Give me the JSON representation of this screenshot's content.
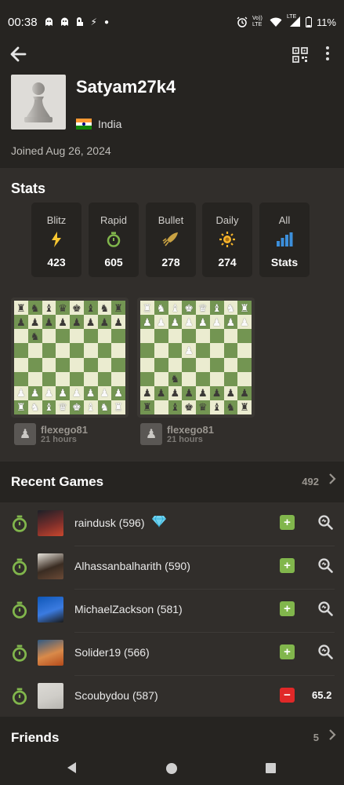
{
  "status_bar": {
    "time": "00:38",
    "notification_icons": [
      "ghost-icon",
      "ghost-icon",
      "notification-icon",
      "bolt-icon",
      "dot-icon"
    ],
    "system_icons": [
      "alarm-icon",
      "volte-icon",
      "wifi-icon",
      "lte-signal-icon",
      "battery-icon"
    ],
    "volte_text": "Vo)) LTE",
    "lte_text": "LTE",
    "battery": "11%"
  },
  "profile": {
    "username": "Satyam27k4",
    "country": "India",
    "joined": "Joined Aug 26, 2024"
  },
  "stats": {
    "title": "Stats",
    "cards": [
      {
        "label": "Blitz",
        "value": "423",
        "icon": "lightning-icon",
        "color": "#f7c631"
      },
      {
        "label": "Rapid",
        "value": "605",
        "icon": "stopwatch-icon",
        "color": "#81b64c"
      },
      {
        "label": "Bullet",
        "value": "278",
        "icon": "bullet-icon",
        "color": "#c9a243"
      },
      {
        "label": "Daily",
        "value": "274",
        "icon": "sun-icon",
        "color": "#f7b52b"
      },
      {
        "label": "All",
        "value": "Stats",
        "icon": "bar-chart-icon",
        "color": "#3c8fdb"
      }
    ]
  },
  "ongoing_games": [
    {
      "opponent": "flexego81",
      "time": "21 hours",
      "board": [
        "rnbqkbnr",
        "pppppppp",
        ".n......",
        "........",
        "........",
        "........",
        "PPPPPPPP",
        "RNBQKBNR"
      ]
    },
    {
      "opponent": "flexego81",
      "time": "21 hours",
      "board": [
        "RNBKQBNR",
        "PPPPPPPP",
        "........",
        "...P....",
        "........",
        "..n.....",
        "pppppppp",
        "r.bkqbnr"
      ]
    }
  ],
  "recent_games": {
    "title": "Recent Games",
    "count": "492",
    "games": [
      {
        "opponent": "raindusk (596)",
        "has_badge": true,
        "result": "win",
        "result_symbol": "+",
        "accuracy": null,
        "avatar_colors": [
          "#1c2028",
          "#7a2e2a",
          "#c9472e"
        ]
      },
      {
        "opponent": "Alhassanbalharith (590)",
        "has_badge": false,
        "result": "win",
        "result_symbol": "+",
        "accuracy": null,
        "avatar_colors": [
          "#e8e4dc",
          "#3a2c22",
          "#6b4a36"
        ]
      },
      {
        "opponent": "MichaelZackson (581)",
        "has_badge": false,
        "result": "win",
        "result_symbol": "+",
        "accuracy": null,
        "avatar_colors": [
          "#0f57b8",
          "#3b7be0",
          "#1a1a1a"
        ]
      },
      {
        "opponent": "Solider19 (566)",
        "has_badge": false,
        "result": "win",
        "result_symbol": "+",
        "accuracy": null,
        "avatar_colors": [
          "#2f5a84",
          "#d98a4a",
          "#b34a1a"
        ]
      },
      {
        "opponent": "Scoubydou (587)",
        "has_badge": false,
        "result": "loss",
        "result_symbol": "−",
        "accuracy": "65.2",
        "avatar_colors": [
          "#dcdad5",
          "#cfcdc8",
          "#b7b5b0"
        ]
      }
    ]
  },
  "friends": {
    "title": "Friends",
    "count": "5"
  },
  "colors": {
    "background": "#262421",
    "panel": "#312e2b",
    "win": "#81b64c",
    "loss": "#e02828",
    "board_light": "#ebecd0",
    "board_dark": "#739552"
  }
}
